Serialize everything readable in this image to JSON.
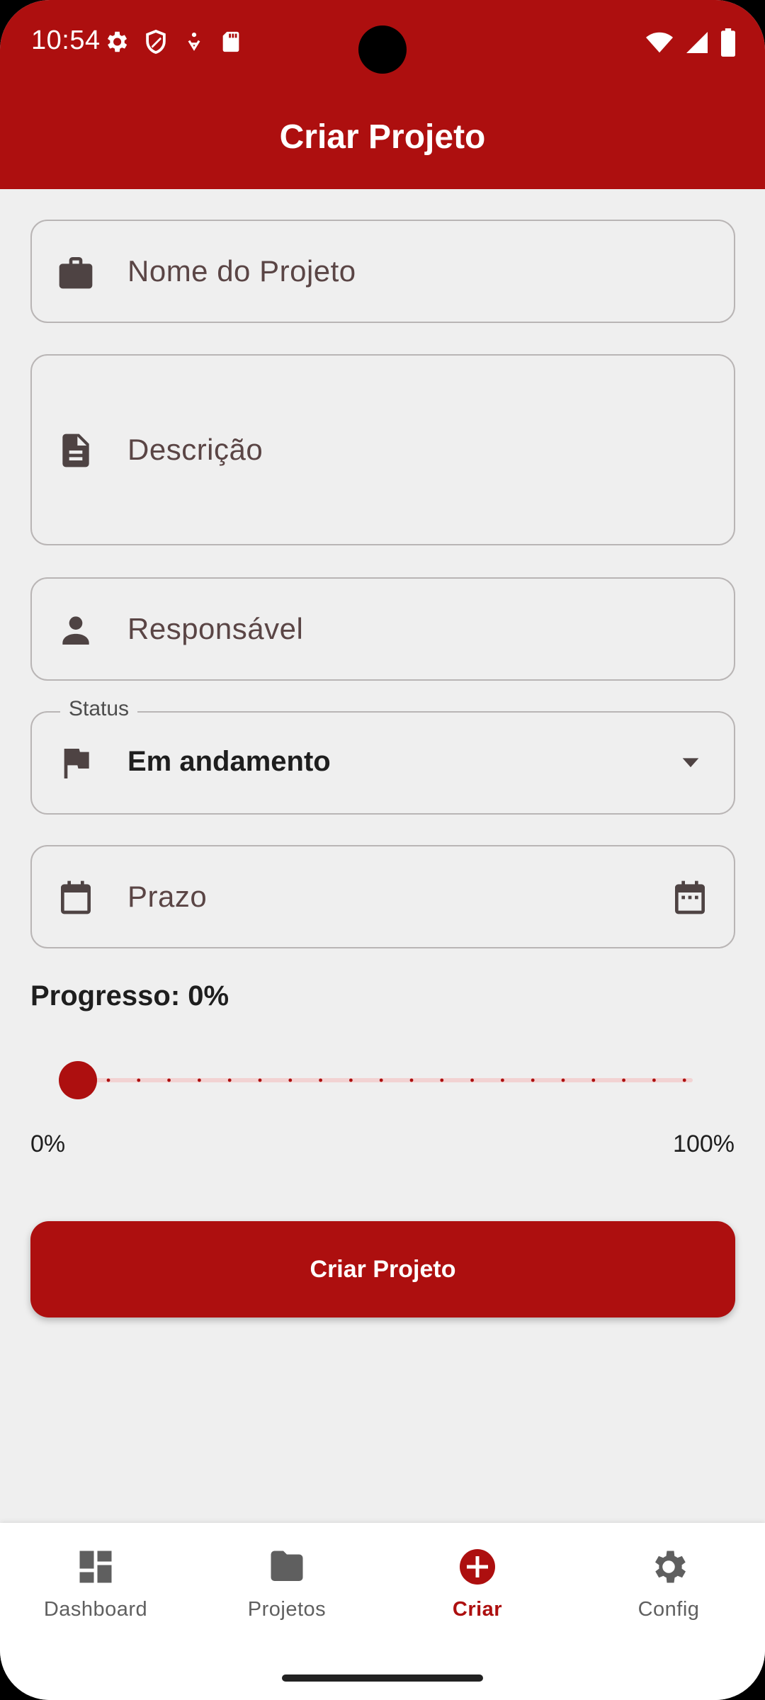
{
  "status_bar": {
    "time": "10:54"
  },
  "app_bar": {
    "title": "Criar Projeto"
  },
  "form": {
    "project_name": {
      "placeholder": "Nome do Projeto",
      "icon": "briefcase-icon"
    },
    "description": {
      "placeholder": "Descrição",
      "icon": "document-icon"
    },
    "responsible": {
      "placeholder": "Responsável",
      "icon": "person-icon"
    },
    "status": {
      "label": "Status",
      "value": "Em andamento",
      "icon": "flag-icon"
    },
    "deadline": {
      "placeholder": "Prazo",
      "icon": "calendar-icon",
      "trailing_icon": "calendar-picker-icon"
    },
    "progress": {
      "label": "Progresso: 0%",
      "value": 0,
      "min_label": "0%",
      "max_label": "100%"
    },
    "submit_label": "Criar Projeto"
  },
  "bottom_nav": {
    "items": [
      {
        "label": "Dashboard",
        "icon": "dashboard-icon",
        "active": false
      },
      {
        "label": "Projetos",
        "icon": "folder-icon",
        "active": false
      },
      {
        "label": "Criar",
        "icon": "add-circle-icon",
        "active": true
      },
      {
        "label": "Config",
        "icon": "gear-icon",
        "active": false
      }
    ]
  },
  "colors": {
    "primary": "#ad0f0f",
    "background": "#efefef",
    "icon": "#4e4343"
  }
}
